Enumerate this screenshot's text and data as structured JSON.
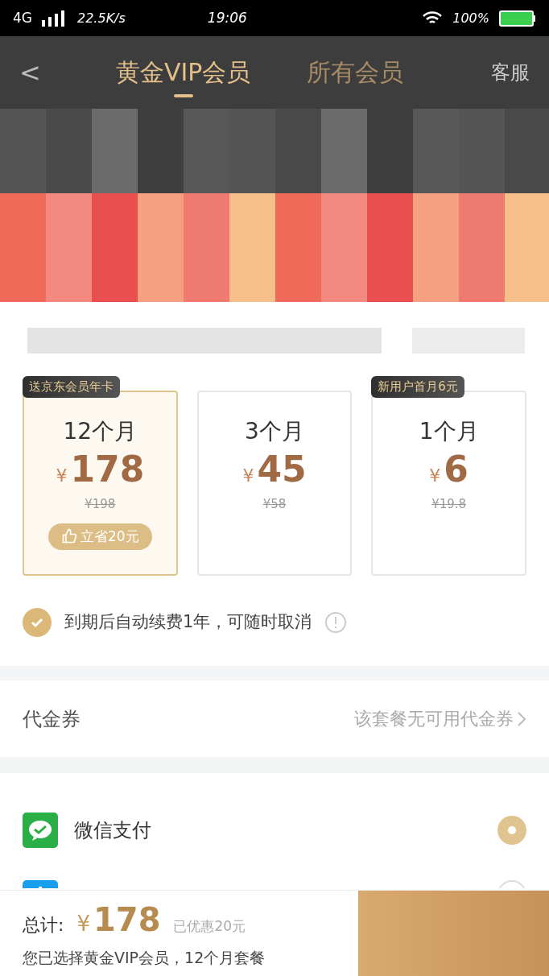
{
  "status_bar": {
    "network": "4G",
    "speed": "22.5K/s",
    "time": "19:06",
    "battery": "100%"
  },
  "header": {
    "back": "<",
    "tabs": [
      {
        "label": "黄金VIP会员",
        "selected": true
      },
      {
        "label": "所有会员",
        "selected": false
      }
    ],
    "service": "客服"
  },
  "plans": [
    {
      "ribbon": "送京东会员年卡",
      "duration": "12个月",
      "currency": "¥",
      "price": "178",
      "original": "¥198",
      "saving": "立省20元",
      "selected": true
    },
    {
      "duration": "3个月",
      "currency": "¥",
      "price": "45",
      "original": "¥58",
      "selected": false
    },
    {
      "ribbon": "新用户首月6元",
      "duration": "1个月",
      "currency": "¥",
      "price": "6",
      "original": "¥19.8",
      "selected": false
    }
  ],
  "auto_renew": {
    "checked": true,
    "text": "到期后自动续费1年，可随时取消"
  },
  "coupon": {
    "label": "代金券",
    "value": "该套餐无可用代金券"
  },
  "payments": [
    {
      "label": "微信支付",
      "kind": "wechat",
      "selected": true
    },
    {
      "kind": "blue",
      "selected": false
    }
  ],
  "footer": {
    "total_label": "总计:",
    "currency": "¥",
    "total": "178",
    "discount": "已优惠20元",
    "summary": "您已选择黄金VIP会员，12个月套餐"
  }
}
